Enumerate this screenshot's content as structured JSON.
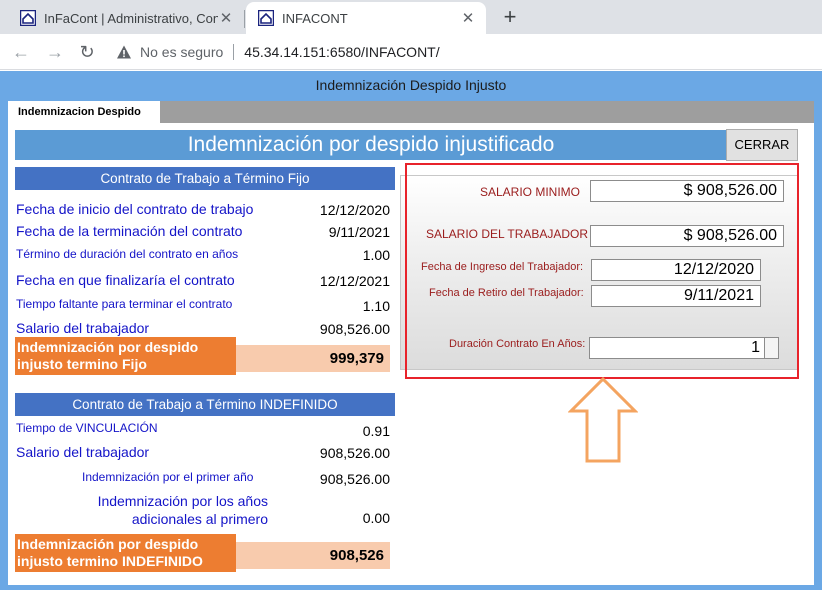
{
  "browser": {
    "tabs": [
      {
        "title": "InFaCont | Administrativo, Contab",
        "close": "✕"
      },
      {
        "title": "INFACONT",
        "close": "✕"
      }
    ],
    "new_tab": "+",
    "security_text": "No es seguro",
    "url": "45.34.14.151:6580/INFACONT/"
  },
  "page": {
    "window_title": "Indemnización Despido Injusto",
    "tab_label": "Indemnizacion Despido",
    "header": "Indemnización por despido injustificado",
    "close_button": "CERRAR"
  },
  "fijo": {
    "title": "Contrato de Trabajo a Término Fijo",
    "rows": [
      {
        "label": "Fecha de inicio del contrato de trabajo",
        "value": "12/12/2020"
      },
      {
        "label": "Fecha de la terminación del contrato",
        "value": "9/11/2021"
      },
      {
        "label": "Término de duración del contrato en años",
        "value": "1.00"
      },
      {
        "label": "Fecha en que finalizaría el contrato",
        "value": "12/12/2021"
      },
      {
        "label": "Tiempo faltante para terminar el contrato",
        "value": "1.10"
      },
      {
        "label": "Salario del trabajador",
        "value": "908,526.00"
      }
    ],
    "result_label": "Indemnización por despido injusto termino Fijo",
    "result_value": "999,379"
  },
  "indefinido": {
    "title": "Contrato de Trabajo a Término INDEFINIDO",
    "rows": [
      {
        "label": "Tiempo de VINCULACIÓN",
        "value": "0.91"
      },
      {
        "label": "Salario del trabajador",
        "value": "908,526.00"
      },
      {
        "label": "Indemnización por el primer año",
        "value": "908,526.00"
      },
      {
        "label": "Indemnización por los años adicionales al primero",
        "value": "0.00"
      }
    ],
    "result_label": "Indemnización por despido injusto termino INDEFINIDO",
    "result_value": "908,526"
  },
  "form": {
    "salario_minimo_label": "SALARIO MINIMO",
    "salario_minimo_value": "$ 908,526.00",
    "salario_trabajador_label": "SALARIO DEL TRABAJADOR",
    "salario_trabajador_value": "$ 908,526.00",
    "fecha_ingreso_label": "Fecha de Ingreso del Trabajador:",
    "fecha_ingreso_value": "12/12/2020",
    "fecha_retiro_label": "Fecha de Retiro del Trabajador:",
    "fecha_retiro_value": "9/11/2021",
    "duracion_label": "Duración Contrato En Años:",
    "duracion_value": "1"
  },
  "colors": {
    "page_bg": "#6ba8e5",
    "header_bar": "#5b9bd5",
    "section_header": "#4472c4",
    "result_label": "#ed7d31",
    "result_value": "#f8cbad",
    "highlight_border": "#e8232b",
    "arrow": "#f4a460"
  }
}
